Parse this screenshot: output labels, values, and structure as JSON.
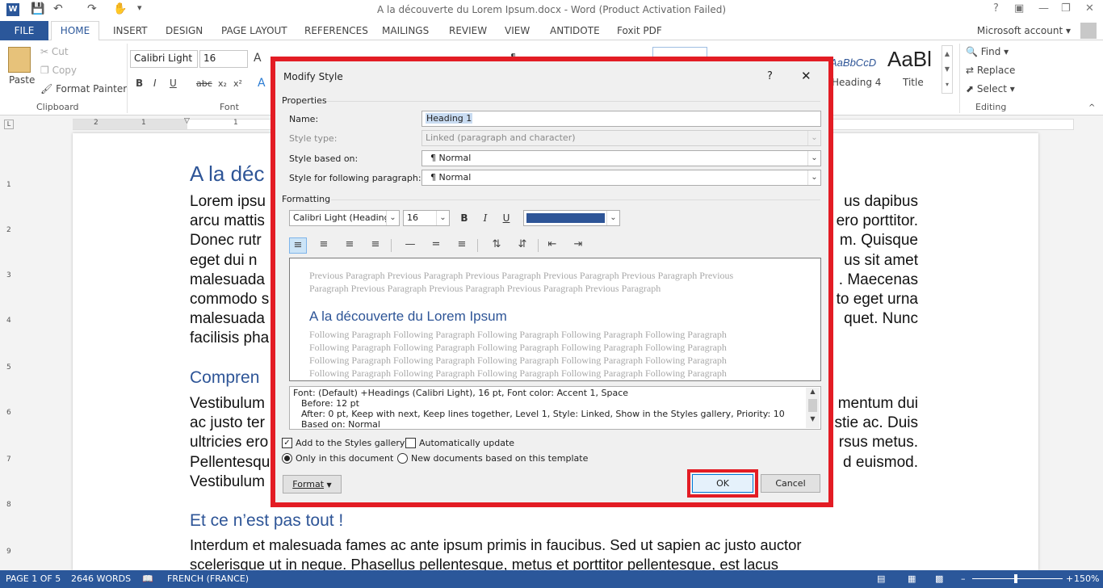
{
  "window": {
    "title": "A la découverte du Lorem Ipsum.docx - Word (Product Activation Failed)",
    "help": "?",
    "logo_letter": "W"
  },
  "tabs": [
    "FILE",
    "HOME",
    "INSERT",
    "DESIGN",
    "PAGE LAYOUT",
    "REFERENCES",
    "MAILINGS",
    "REVIEW",
    "VIEW",
    "ANTIDOTE",
    "Foxit PDF"
  ],
  "account": "Microsoft account",
  "ribbon": {
    "clipboard": {
      "paste": "Paste",
      "cut": "Cut",
      "copy": "Copy",
      "format_painter": "Format Painter",
      "label": "Clipboard"
    },
    "font": {
      "name": "Calibri Light",
      "size": "16",
      "label": "Font",
      "grow": "A"
    },
    "styles": {
      "heading4": "Heading 4",
      "title": "Title",
      "sample": "AaBbCcD",
      "title_sample": "AaBl"
    },
    "editing": {
      "find": "Find",
      "replace": "Replace",
      "select": "Select",
      "label": "Editing"
    }
  },
  "ruler": {
    "marks": [
      "2",
      "1",
      "1",
      "2"
    ]
  },
  "vruler": {
    "marks": [
      "1",
      "2",
      "3",
      "4",
      "5",
      "6",
      "7",
      "8",
      "9"
    ]
  },
  "document": {
    "heading1": "A la déc",
    "para1": [
      "Lorem ipsu",
      "arcu mattis",
      "Donec rutr",
      "eget dui n",
      "malesuada",
      "commodo s",
      "malesuada",
      "facilisis pha"
    ],
    "para1_right": [
      "us dapibus",
      "ero porttitor.",
      "m. Quisque",
      "us sit amet",
      ". Maecenas",
      "to eget urna",
      "quet. Nunc",
      ""
    ],
    "heading2": "Compren",
    "para2": [
      "Vestibulum",
      "ac justo ter",
      "ultricies ero",
      "Pellentesqu",
      "Vestibulum"
    ],
    "para2_right": [
      "mentum dui",
      "stie ac. Duis",
      "rsus metus.",
      "d euismod.",
      ""
    ],
    "heading3": "Et ce n’est pas tout !",
    "para3": [
      "Interdum et malesuada fames ac ante ipsum primis in faucibus. Sed ut sapien ac justo auctor",
      "scelerisque ut in neque. Phasellus pellentesque, metus et porttitor pellentesque, est lacus"
    ]
  },
  "statusbar": {
    "page": "PAGE 1 OF 5",
    "words": "2646 WORDS",
    "language": "FRENCH (FRANCE)",
    "zoom": "150%"
  },
  "dialog": {
    "title": "Modify Style",
    "help": "?",
    "properties_label": "Properties",
    "name_label": "Name:",
    "name_value": "Heading 1",
    "style_type_label": "Style type:",
    "style_type_value": "Linked (paragraph and character)",
    "based_on_label": "Style based on:",
    "based_on_value": "Normal",
    "following_label": "Style for following paragraph:",
    "following_value": "Normal",
    "formatting_label": "Formatting",
    "font_value": "Calibri Light (Headings",
    "size_value": "16",
    "bold": "B",
    "italic": "I",
    "underline": "U",
    "font_color": "#2e5597",
    "preview": {
      "previous": [
        "Previous Paragraph Previous Paragraph Previous Paragraph Previous Paragraph Previous Paragraph Previous",
        "Paragraph Previous Paragraph Previous Paragraph Previous Paragraph Previous Paragraph"
      ],
      "sample_heading": "A la découverte du Lorem Ipsum",
      "following": [
        "Following Paragraph Following Paragraph Following Paragraph Following Paragraph Following Paragraph",
        "Following Paragraph Following Paragraph Following Paragraph Following Paragraph Following Paragraph",
        "Following Paragraph Following Paragraph Following Paragraph Following Paragraph Following Paragraph",
        "Following Paragraph Following Paragraph Following Paragraph Following Paragraph Following Paragraph"
      ]
    },
    "description": [
      "Font: (Default) +Headings (Calibri Light), 16 pt, Font color: Accent 1, Space",
      "Before:  12 pt",
      "After:  0 pt, Keep with next, Keep lines together, Level 1, Style: Linked, Show in the Styles gallery, Priority: 10",
      "Based on: Normal"
    ],
    "add_to_gallery": "Add to the Styles gallery",
    "auto_update": "Automatically update",
    "only_this_doc": "Only in this document",
    "new_docs": "New documents based on this template",
    "format_button": "Format",
    "ok": "OK",
    "cancel": "Cancel"
  }
}
